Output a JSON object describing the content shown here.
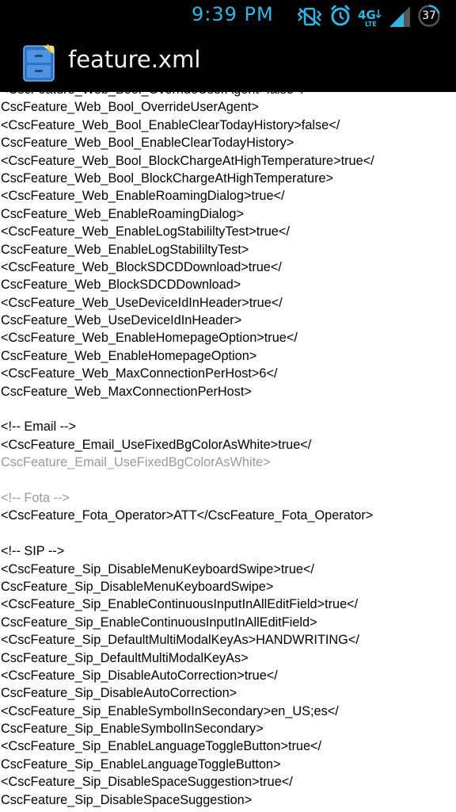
{
  "status_bar": {
    "time": "9:39 PM",
    "battery_level": "37",
    "icons": [
      "vibrate-icon",
      "alarm-icon",
      "4g-lte-icon",
      "signal-icon",
      "battery-icon"
    ],
    "accent_color": "#33b5e5"
  },
  "action_bar": {
    "title": "feature.xml",
    "icon": "file-cabinet-icon"
  },
  "content": {
    "lines": [
      {
        "text": "<CscFeature_Web_Bool_OverrideUserAgent>false</",
        "gray": false
      },
      {
        "text": "CscFeature_Web_Bool_OverrideUserAgent>",
        "gray": false
      },
      {
        "text": "<CscFeature_Web_Bool_EnableClearTodayHistory>false</",
        "gray": false
      },
      {
        "text": "CscFeature_Web_Bool_EnableClearTodayHistory>",
        "gray": false
      },
      {
        "text": "<CscFeature_Web_Bool_BlockChargeAtHighTemperature>true</",
        "gray": false
      },
      {
        "text": "CscFeature_Web_Bool_BlockChargeAtHighTemperature>",
        "gray": false
      },
      {
        "text": "<CscFeature_Web_EnableRoamingDialog>true</",
        "gray": false
      },
      {
        "text": "CscFeature_Web_EnableRoamingDialog>",
        "gray": false
      },
      {
        "text": "<CscFeature_Web_EnableLogStabililtyTest>true</",
        "gray": false
      },
      {
        "text": "CscFeature_Web_EnableLogStabililtyTest>",
        "gray": false
      },
      {
        "text": "<CscFeature_Web_BlockSDCDDownload>true</",
        "gray": false
      },
      {
        "text": "CscFeature_Web_BlockSDCDDownload>",
        "gray": false
      },
      {
        "text": "<CscFeature_Web_UseDeviceIdInHeader>true</",
        "gray": false
      },
      {
        "text": "CscFeature_Web_UseDeviceIdInHeader>",
        "gray": false
      },
      {
        "text": "<CscFeature_Web_EnableHomepageOption>true</",
        "gray": false
      },
      {
        "text": "CscFeature_Web_EnableHomepageOption>",
        "gray": false
      },
      {
        "text": "<CscFeature_Web_MaxConnectionPerHost>6</",
        "gray": false
      },
      {
        "text": "CscFeature_Web_MaxConnectionPerHost>",
        "gray": false
      },
      {
        "text": "",
        "gray": false
      },
      {
        "text": "<!-- Email -->",
        "gray": false
      },
      {
        "text": "<CscFeature_Email_UseFixedBgColorAsWhite>true</",
        "gray": false
      },
      {
        "text": "CscFeature_Email_UseFixedBgColorAsWhite>",
        "gray": true
      },
      {
        "text": "",
        "gray": false
      },
      {
        "text": "<!-- Fota -->",
        "gray": true
      },
      {
        "text": "<CscFeature_Fota_Operator>ATT</CscFeature_Fota_Operator>",
        "gray": false
      },
      {
        "text": "",
        "gray": false
      },
      {
        "text": "<!-- SIP -->",
        "gray": false
      },
      {
        "text": "<CscFeature_Sip_DisableMenuKeyboardSwipe>true</",
        "gray": false
      },
      {
        "text": "CscFeature_Sip_DisableMenuKeyboardSwipe>",
        "gray": false
      },
      {
        "text": "<CscFeature_Sip_EnableContinuousInputInAllEditField>true</",
        "gray": false
      },
      {
        "text": "CscFeature_Sip_EnableContinuousInputInAllEditField>",
        "gray": false
      },
      {
        "text": "<CscFeature_Sip_DefaultMultiModalKeyAs>HANDWRITING</",
        "gray": false
      },
      {
        "text": "CscFeature_Sip_DefaultMultiModalKeyAs>",
        "gray": false
      },
      {
        "text": "<CscFeature_Sip_DisableAutoCorrection>true</",
        "gray": false
      },
      {
        "text": "CscFeature_Sip_DisableAutoCorrection>",
        "gray": false
      },
      {
        "text": "<CscFeature_Sip_EnableSymbolInSecondary>en_US;es</",
        "gray": false
      },
      {
        "text": "CscFeature_Sip_EnableSymbolInSecondary>",
        "gray": false
      },
      {
        "text": "<CscFeature_Sip_EnableLanguageToggleButton>true</",
        "gray": false
      },
      {
        "text": "CscFeature_Sip_EnableLanguageToggleButton>",
        "gray": false
      },
      {
        "text": "<CscFeature_Sip_DisableSpaceSuggestion>true</",
        "gray": false
      },
      {
        "text": "CscFeature_Sip_DisableSpaceSuggestion>",
        "gray": false
      }
    ]
  }
}
